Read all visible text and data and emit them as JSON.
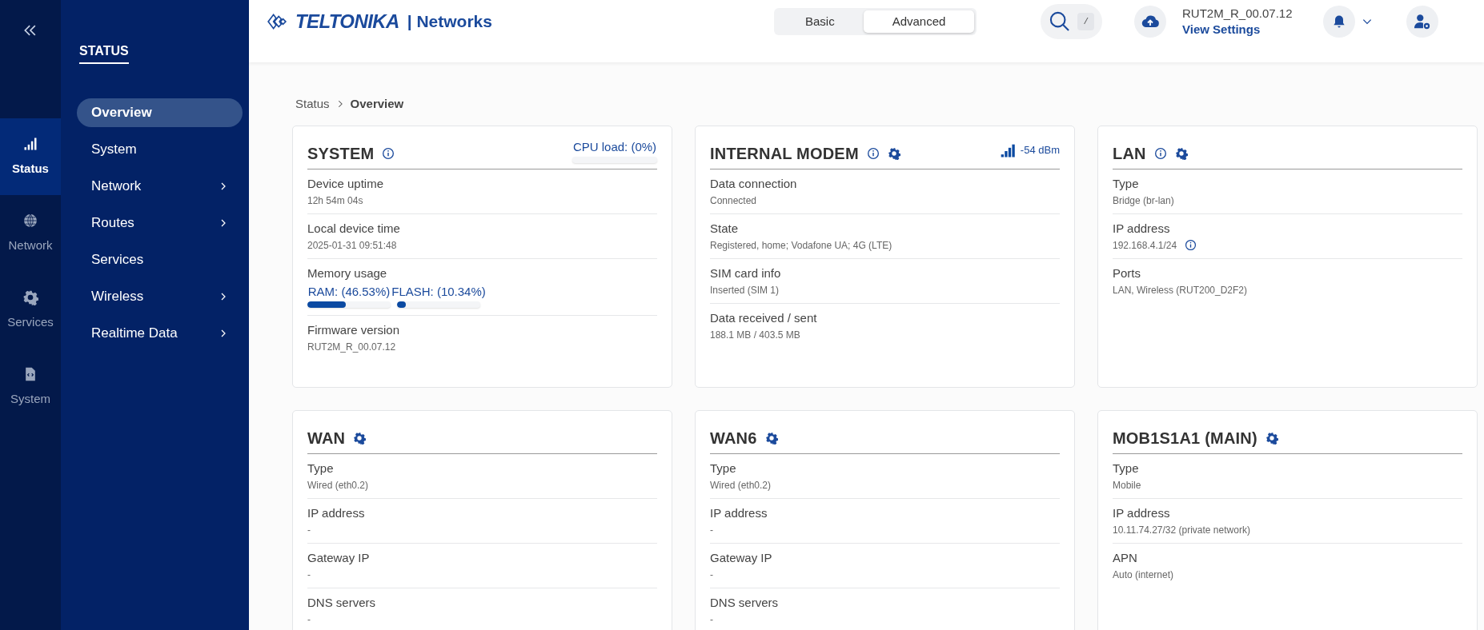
{
  "rail": {
    "items": [
      {
        "label": "Status",
        "selected": true
      },
      {
        "label": "Network",
        "selected": false
      },
      {
        "label": "Services",
        "selected": false
      },
      {
        "label": "System",
        "selected": false
      }
    ]
  },
  "nav": {
    "title": "STATUS",
    "items": [
      {
        "label": "Overview",
        "selected": true,
        "expandable": false
      },
      {
        "label": "System",
        "selected": false,
        "expandable": false
      },
      {
        "label": "Network",
        "selected": false,
        "expandable": true
      },
      {
        "label": "Routes",
        "selected": false,
        "expandable": true
      },
      {
        "label": "Services",
        "selected": false,
        "expandable": false
      },
      {
        "label": "Wireless",
        "selected": false,
        "expandable": true
      },
      {
        "label": "Realtime Data",
        "selected": false,
        "expandable": true
      }
    ]
  },
  "header": {
    "logo": {
      "brand": "TELTONIKA",
      "suffix": "| Networks"
    },
    "modes": [
      {
        "label": "Basic",
        "selected": false
      },
      {
        "label": "Advanced",
        "selected": true
      }
    ],
    "search_key": "/",
    "firmware": "RUT2M_R_00.07.12",
    "settings_link": "View Settings"
  },
  "breadcrumb": [
    "Status",
    "Overview"
  ],
  "cards": [
    {
      "title": "SYSTEM",
      "info": true,
      "gear": false,
      "extra": {
        "kind": "meter",
        "label": "CPU load: (0%)",
        "level": 0
      },
      "rows": [
        {
          "kind": "text",
          "label": "Device uptime",
          "value": "12h 54m 04s"
        },
        {
          "kind": "text",
          "label": "Local device time",
          "value": "2025-01-31 09:51:48"
        },
        {
          "kind": "meters",
          "label": "Memory usage",
          "meters": [
            {
              "label": "RAM: (46.53%)",
              "level": 0.4653
            },
            {
              "label": "FLASH: (10.34%)",
              "level": 0.1034
            }
          ]
        },
        {
          "kind": "text",
          "label": "Firmware version",
          "value": "RUT2M_R_00.07.12"
        }
      ]
    },
    {
      "title": "INTERNAL MODEM",
      "info": true,
      "gear": true,
      "extra": {
        "kind": "signal",
        "label": "-54 dBm"
      },
      "rows": [
        {
          "kind": "text",
          "label": "Data connection",
          "value": "Connected"
        },
        {
          "kind": "text",
          "label": "State",
          "value": "Registered, home; Vodafone UA; 4G (LTE)"
        },
        {
          "kind": "text",
          "label": "SIM card info",
          "value": "Inserted (SIM 1)"
        },
        {
          "kind": "text",
          "label": "Data received / sent",
          "value": "188.1 MB / 403.5 MB"
        }
      ]
    },
    {
      "title": "LAN",
      "info": true,
      "gear": true,
      "rows": [
        {
          "kind": "text",
          "label": "Type",
          "value": "Bridge (br-lan)"
        },
        {
          "kind": "text",
          "label": "IP address",
          "value": "192.168.4.1/24",
          "info": true
        },
        {
          "kind": "text",
          "label": "Ports",
          "value": "LAN, Wireless (RUT200_D2F2)"
        }
      ]
    },
    {
      "title": "WAN",
      "info": false,
      "gear": true,
      "rows": [
        {
          "kind": "text",
          "label": "Type",
          "value": "Wired (eth0.2)"
        },
        {
          "kind": "text",
          "label": "IP address",
          "value": "-"
        },
        {
          "kind": "text",
          "label": "Gateway IP",
          "value": "-"
        },
        {
          "kind": "text",
          "label": "DNS servers",
          "value": "-"
        }
      ]
    },
    {
      "title": "WAN6",
      "info": false,
      "gear": true,
      "rows": [
        {
          "kind": "text",
          "label": "Type",
          "value": "Wired (eth0.2)"
        },
        {
          "kind": "text",
          "label": "IP address",
          "value": "-"
        },
        {
          "kind": "text",
          "label": "Gateway IP",
          "value": "-"
        },
        {
          "kind": "text",
          "label": "DNS servers",
          "value": "-"
        }
      ]
    },
    {
      "title": "MOB1S1A1 (MAIN)",
      "info": false,
      "gear": true,
      "rows": [
        {
          "kind": "text",
          "label": "Type",
          "value": "Mobile"
        },
        {
          "kind": "text",
          "label": "IP address",
          "value": "10.11.74.27/32 (private network)"
        },
        {
          "kind": "text",
          "label": "APN",
          "value": "Auto (internet)"
        }
      ]
    }
  ]
}
